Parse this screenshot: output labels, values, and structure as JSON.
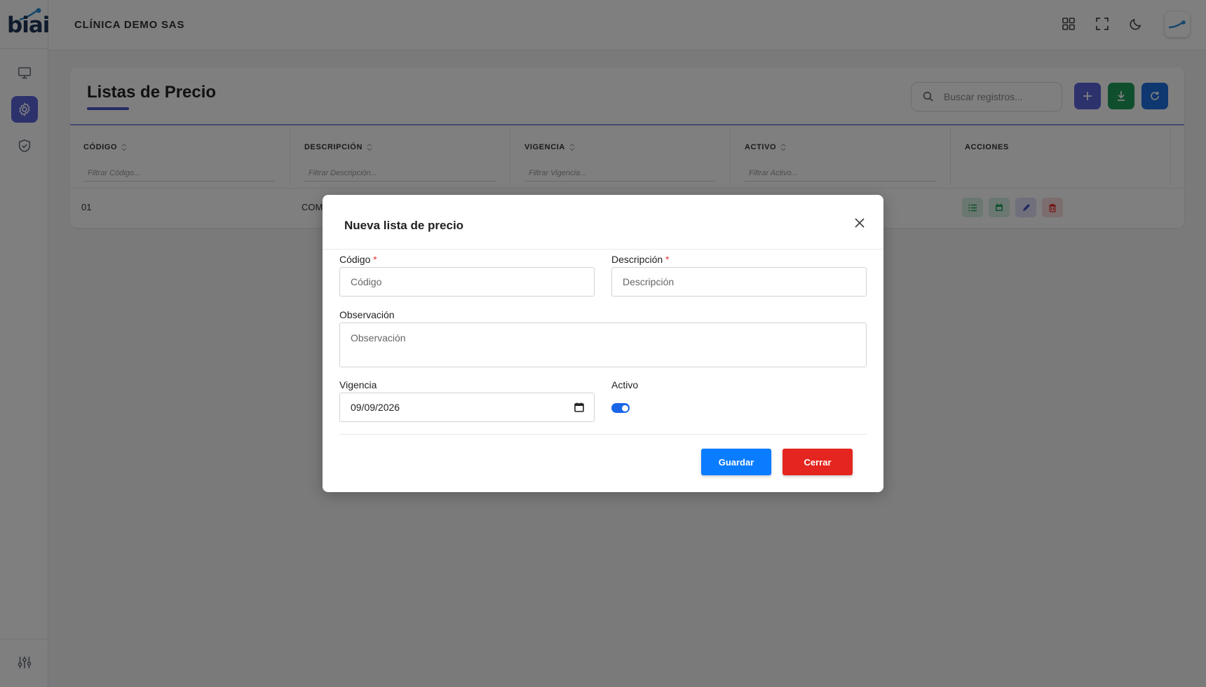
{
  "app": {
    "logo_text": "biai",
    "company": "CLÍNICA DEMO SAS"
  },
  "page": {
    "title": "Listas de Precio",
    "search_placeholder": "Buscar registros..."
  },
  "table": {
    "columns": [
      {
        "label": "CÓDIGO",
        "filter_placeholder": "Filtrar Código..."
      },
      {
        "label": "DESCRIPCIÓN",
        "filter_placeholder": "Filtrar Descripción..."
      },
      {
        "label": "VIGENCIA",
        "filter_placeholder": "Filtrar Vigencia..."
      },
      {
        "label": "ACTIVO",
        "filter_placeholder": "Filtrar Activo..."
      },
      {
        "label": "ACCIONES"
      }
    ],
    "rows": [
      {
        "codigo": "01",
        "descripcion": "COM"
      }
    ]
  },
  "modal": {
    "title": "Nueva lista de precio",
    "codigo_label": "Código",
    "codigo_placeholder": "Código",
    "descripcion_label": "Descripción",
    "descripcion_placeholder": "Descripción",
    "required_mark": "*",
    "observacion_label": "Observación",
    "observacion_placeholder": "Observación",
    "vigencia_label": "Vigencia",
    "vigencia_value": "09/09/2026",
    "activo_label": "Activo",
    "activo_checked": true,
    "save_label": "Guardar",
    "close_label": "Cerrar"
  },
  "colors": {
    "accent": "#5a63d8",
    "save": "#0a7cff",
    "danger": "#e5251f",
    "success": "#1e9e5a",
    "refresh": "#1f6fe0"
  },
  "icons": [
    "monitor-icon",
    "gear-icon",
    "shield-check-icon",
    "sliders-icon",
    "grid-icon",
    "fullscreen-icon",
    "moon-icon",
    "search-icon",
    "plus-icon",
    "download-icon",
    "refresh-icon",
    "sort-icon",
    "list-icon",
    "calendar-icon",
    "pencil-icon",
    "trash-icon",
    "close-icon"
  ]
}
